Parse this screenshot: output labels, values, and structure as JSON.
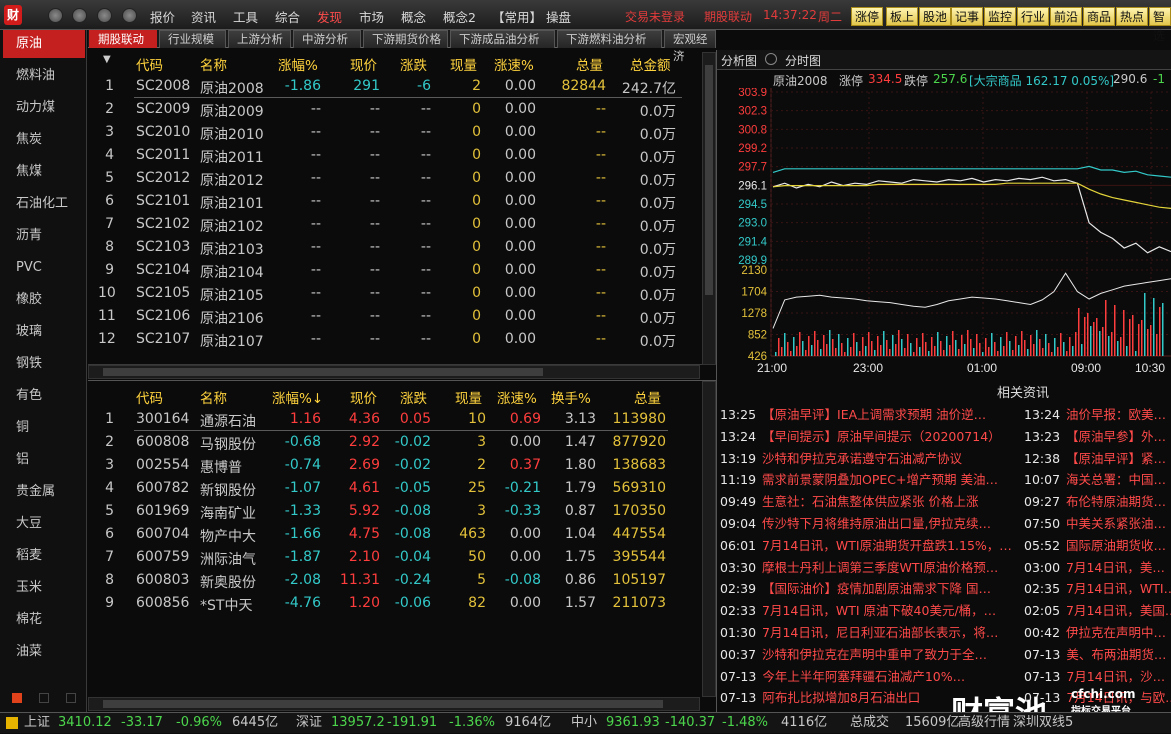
{
  "app": {
    "logo_text": "财",
    "menus": [
      "报价",
      "资讯",
      "工具",
      "综合",
      "发现",
      "市场",
      "概念",
      "概念2",
      "【常用】",
      "操盘"
    ],
    "active_menu": "发现",
    "trade_status": "交易未登录",
    "module": "期股联动",
    "clock": "14:37:22",
    "weekday": "周二",
    "quick_tabs": [
      "涨停",
      "板上",
      "股池",
      "记事",
      "监控",
      "行业",
      "前沿",
      "商品",
      "热点",
      "智选"
    ]
  },
  "sidebar": {
    "items": [
      "原油",
      "燃料油",
      "动力煤",
      "焦炭",
      "焦煤",
      "石油化工",
      "沥青",
      "PVC",
      "橡胶",
      "玻璃",
      "钢铁",
      "有色",
      "铜",
      "铝",
      "贵金属",
      "大豆",
      "稻麦",
      "玉米",
      "棉花",
      "油菜"
    ],
    "active": 0
  },
  "tabs": [
    "期股联动",
    "行业规模",
    "上游分析",
    "中游分析",
    "下游期货价格",
    "下游成品油分析",
    "下游燃料油分析",
    "宏观经济"
  ],
  "futures_table": {
    "headers": [
      "代码",
      "名称",
      "涨幅%",
      "现价",
      "涨跌",
      "现量",
      "涨速%",
      "总量",
      "总金额"
    ],
    "rows": [
      {
        "no": "1",
        "code": "SC2008",
        "name": "原油2008",
        "chg_pct": "-1.86",
        "price": "291",
        "chg": "-6",
        "vol": "2",
        "speed": "0.00",
        "total": "82844",
        "amount": "242.7亿"
      },
      {
        "no": "2",
        "code": "SC2009",
        "name": "原油2009",
        "chg_pct": "--",
        "price": "--",
        "chg": "--",
        "vol": "0",
        "speed": "0.00",
        "total": "--",
        "amount": "0.0万"
      },
      {
        "no": "3",
        "code": "SC2010",
        "name": "原油2010",
        "chg_pct": "--",
        "price": "--",
        "chg": "--",
        "vol": "0",
        "speed": "0.00",
        "total": "--",
        "amount": "0.0万"
      },
      {
        "no": "4",
        "code": "SC2011",
        "name": "原油2011",
        "chg_pct": "--",
        "price": "--",
        "chg": "--",
        "vol": "0",
        "speed": "0.00",
        "total": "--",
        "amount": "0.0万"
      },
      {
        "no": "5",
        "code": "SC2012",
        "name": "原油2012",
        "chg_pct": "--",
        "price": "--",
        "chg": "--",
        "vol": "0",
        "speed": "0.00",
        "total": "--",
        "amount": "0.0万"
      },
      {
        "no": "6",
        "code": "SC2101",
        "name": "原油2101",
        "chg_pct": "--",
        "price": "--",
        "chg": "--",
        "vol": "0",
        "speed": "0.00",
        "total": "--",
        "amount": "0.0万"
      },
      {
        "no": "7",
        "code": "SC2102",
        "name": "原油2102",
        "chg_pct": "--",
        "price": "--",
        "chg": "--",
        "vol": "0",
        "speed": "0.00",
        "total": "--",
        "amount": "0.0万"
      },
      {
        "no": "8",
        "code": "SC2103",
        "name": "原油2103",
        "chg_pct": "--",
        "price": "--",
        "chg": "--",
        "vol": "0",
        "speed": "0.00",
        "total": "--",
        "amount": "0.0万"
      },
      {
        "no": "9",
        "code": "SC2104",
        "name": "原油2104",
        "chg_pct": "--",
        "price": "--",
        "chg": "--",
        "vol": "0",
        "speed": "0.00",
        "total": "--",
        "amount": "0.0万"
      },
      {
        "no": "10",
        "code": "SC2105",
        "name": "原油2105",
        "chg_pct": "--",
        "price": "--",
        "chg": "--",
        "vol": "0",
        "speed": "0.00",
        "total": "--",
        "amount": "0.0万"
      },
      {
        "no": "11",
        "code": "SC2106",
        "name": "原油2106",
        "chg_pct": "--",
        "price": "--",
        "chg": "--",
        "vol": "0",
        "speed": "0.00",
        "total": "--",
        "amount": "0.0万"
      },
      {
        "no": "12",
        "code": "SC2107",
        "name": "原油2107",
        "chg_pct": "--",
        "price": "--",
        "chg": "--",
        "vol": "0",
        "speed": "0.00",
        "total": "--",
        "amount": "0.0万"
      }
    ]
  },
  "stocks_table": {
    "headers": [
      "代码",
      "名称",
      "涨幅%↓",
      "现价",
      "涨跌",
      "现量",
      "涨速%",
      "换手%",
      "总量"
    ],
    "rows": [
      {
        "no": "1",
        "code": "300164",
        "name": "通源石油",
        "chg_pct": "1.16",
        "price": "4.36",
        "chg": "0.05",
        "vol": "10",
        "speed": "0.69",
        "turnover": "3.13",
        "total": "113980"
      },
      {
        "no": "2",
        "code": "600808",
        "name": "马钢股份",
        "chg_pct": "-0.68",
        "price": "2.92",
        "chg": "-0.02",
        "vol": "3",
        "speed": "0.00",
        "turnover": "1.47",
        "total": "877920"
      },
      {
        "no": "3",
        "code": "002554",
        "name": "惠博普",
        "chg_pct": "-0.74",
        "price": "2.69",
        "chg": "-0.02",
        "vol": "2",
        "speed": "0.37",
        "turnover": "1.80",
        "total": "138683"
      },
      {
        "no": "4",
        "code": "600782",
        "name": "新钢股份",
        "chg_pct": "-1.07",
        "price": "4.61",
        "chg": "-0.05",
        "vol": "25",
        "speed": "-0.21",
        "turnover": "1.79",
        "total": "569310"
      },
      {
        "no": "5",
        "code": "601969",
        "name": "海南矿业",
        "chg_pct": "-1.33",
        "price": "5.92",
        "chg": "-0.08",
        "vol": "3",
        "speed": "-0.33",
        "turnover": "0.87",
        "total": "170350"
      },
      {
        "no": "6",
        "code": "600704",
        "name": "物产中大",
        "chg_pct": "-1.66",
        "price": "4.75",
        "chg": "-0.08",
        "vol": "463",
        "speed": "0.00",
        "turnover": "1.04",
        "total": "447554"
      },
      {
        "no": "7",
        "code": "600759",
        "name": "洲际油气",
        "chg_pct": "-1.87",
        "price": "2.10",
        "chg": "-0.04",
        "vol": "50",
        "speed": "0.00",
        "turnover": "1.75",
        "total": "395544"
      },
      {
        "no": "8",
        "code": "600803",
        "name": "新奥股份",
        "chg_pct": "-2.08",
        "price": "11.31",
        "chg": "-0.24",
        "vol": "5",
        "speed": "-0.08",
        "turnover": "0.86",
        "total": "105197"
      },
      {
        "no": "9",
        "code": "600856",
        "name": "*ST中天",
        "chg_pct": "-4.76",
        "price": "1.20",
        "chg": "-0.06",
        "vol": "82",
        "speed": "0.00",
        "turnover": "1.57",
        "total": "211073"
      }
    ]
  },
  "chart_panel": {
    "tabs": [
      "分析图",
      "分时图"
    ],
    "info_name": "原油2008",
    "info_limit_up_label": "涨停",
    "info_limit_up": "334.5",
    "info_limit_down_label": "跌停",
    "info_limit_down": "257.6",
    "info_commodity": "[大宗商品 162.17 0.05%]",
    "info_last": "290.6",
    "info_last_chg": "-1"
  },
  "chart_data": {
    "type": "line",
    "price_axis_labels": [
      "303.9",
      "302.3",
      "300.8",
      "299.2",
      "297.7",
      "296.1",
      "294.5",
      "293.0",
      "291.4",
      "289.9"
    ],
    "volume_axis_labels": [
      "2130",
      "1704",
      "1278",
      "852",
      "426"
    ],
    "x_tick_labels": [
      "21:00",
      "23:00",
      "01:00",
      "09:00",
      "10:30"
    ],
    "ylim": [
      289.9,
      303.9
    ],
    "prev_close": 296.1,
    "series": [
      {
        "values": [
          296.0,
          296.3,
          295.9,
          296.2,
          296.0,
          296.4,
          296.1,
          296.3,
          296.2,
          296.5,
          296.4,
          296.3,
          296.6,
          296.5,
          296.4,
          296.6,
          296.5,
          296.7,
          296.4,
          296.6,
          296.5,
          296.7,
          296.6,
          296.8,
          296.5,
          296.6,
          296.3,
          293.0,
          292.2,
          291.7,
          290.9,
          291.3,
          290.5,
          291.0,
          290.6
        ]
      },
      {
        "values": [
          296.0,
          296.1,
          296.1,
          296.1,
          296.1,
          296.1,
          296.1,
          296.1,
          296.1,
          296.2,
          296.2,
          296.2,
          296.2,
          296.2,
          296.2,
          296.2,
          296.2,
          296.2,
          296.2,
          296.2,
          296.3,
          296.3,
          296.3,
          296.3,
          296.3,
          296.3,
          296.3,
          295.8,
          295.4,
          295.1,
          294.9,
          294.7,
          294.5,
          294.3,
          294.2
        ]
      },
      {
        "values": [
          297.2,
          297.5,
          297.5,
          297.5,
          297.5,
          297.5,
          297.5,
          297.5,
          297.5,
          297.5,
          297.5,
          297.5,
          297.5,
          297.5,
          297.5,
          297.5,
          297.5,
          297.5,
          297.5,
          297.5,
          297.5,
          297.5,
          297.5,
          297.5,
          297.5,
          297.5,
          297.5,
          297.7,
          297.4,
          297.4,
          297.2,
          297.3,
          297.0,
          296.9,
          296.8
        ]
      }
    ],
    "open_interest": [
      300,
      610,
      640,
      650,
      660,
      640,
      630,
      620,
      600,
      590,
      580,
      560,
      540,
      530,
      560,
      600,
      620,
      640,
      630,
      620,
      600,
      580,
      560,
      610,
      700,
      900,
      700,
      620,
      680,
      720,
      760,
      780,
      800,
      820,
      840
    ]
  },
  "news": {
    "title": "相关资讯",
    "left": [
      {
        "time": "13:25",
        "text": "【原油早评】IEA上调需求预期 油价逆…"
      },
      {
        "time": "13:24",
        "text": "【早间提示】原油早间提示（20200714）"
      },
      {
        "time": "13:19",
        "text": "沙特和伊拉克承诺遵守石油减产协议"
      },
      {
        "time": "11:19",
        "text": "需求前景蒙阴叠加OPEC+增产预期 美油…"
      },
      {
        "time": "09:49",
        "text": "生意社：石油焦整体供应紧张 价格上涨"
      },
      {
        "time": "09:04",
        "text": "传沙特下月将维持原油出口量,伊拉克续…"
      },
      {
        "time": "06:01",
        "text": "7月14日讯，WTI原油期货开盘跌1.15%，…"
      },
      {
        "time": "03:30",
        "text": "摩根士丹利上调第三季度WTI原油价格预…"
      },
      {
        "time": "02:39",
        "text": "【国际油价】疫情加剧原油需求下降 国…"
      },
      {
        "time": "02:33",
        "text": "7月14日讯，WTI 原油下破40美元/桶，…"
      },
      {
        "time": "01:30",
        "text": "7月14日讯，尼日利亚石油部长表示，将…"
      },
      {
        "time": "00:37",
        "text": "沙特和伊拉克在声明中重申了致力于全…"
      },
      {
        "time": "07-13",
        "text": "今年上半年阿塞拜疆石油减产10%…"
      },
      {
        "time": "07-13",
        "text": "阿布扎比拟增加8月石油出口"
      }
    ],
    "right": [
      {
        "time": "13:24",
        "text": "油价早报：欧美…"
      },
      {
        "time": "13:23",
        "text": "【原油早参】外…"
      },
      {
        "time": "12:38",
        "text": "【原油早评】紧…"
      },
      {
        "time": "10:07",
        "text": "海关总署：中国…"
      },
      {
        "time": "09:27",
        "text": "布伦特原油期货…"
      },
      {
        "time": "07:50",
        "text": "中美关系紧张油…"
      },
      {
        "time": "05:52",
        "text": "国际原油期货收…"
      },
      {
        "time": "03:00",
        "text": "7月14日讯，美…"
      },
      {
        "time": "02:35",
        "text": "7月14日讯，WTI…"
      },
      {
        "time": "02:05",
        "text": "7月14日讯，美国…"
      },
      {
        "time": "00:42",
        "text": "伊拉克在声明中…"
      },
      {
        "time": "07-13",
        "text": "美、布两油期货…"
      },
      {
        "time": "07-13",
        "text": "7月14日讯，沙…"
      },
      {
        "time": "07-13",
        "text": "7月14日讯，与欧…"
      }
    ]
  },
  "watermark": {
    "brand": "财富池",
    "site": "cfchi.com",
    "slogan": "指标交易平台"
  },
  "status": {
    "sh_name": "上证",
    "sh_val": "3410.12",
    "sh_chg": "-33.17",
    "sh_pct": "-0.96%",
    "sh_amt": "6445亿",
    "sz_name": "深证",
    "sz_val": "13957.2",
    "sz_chg": "-191.91",
    "sz_pct": "-1.36%",
    "sz_amt": "9164亿",
    "zx_name": "中小",
    "zx_val": "9361.93",
    "zx_chg": "-140.37",
    "zx_pct": "-1.48%",
    "zx_amt": "4116亿",
    "total_label": "总成交",
    "total_val": "15609亿",
    "quote_label": "高级行情",
    "dual_label": "深圳双线5"
  }
}
